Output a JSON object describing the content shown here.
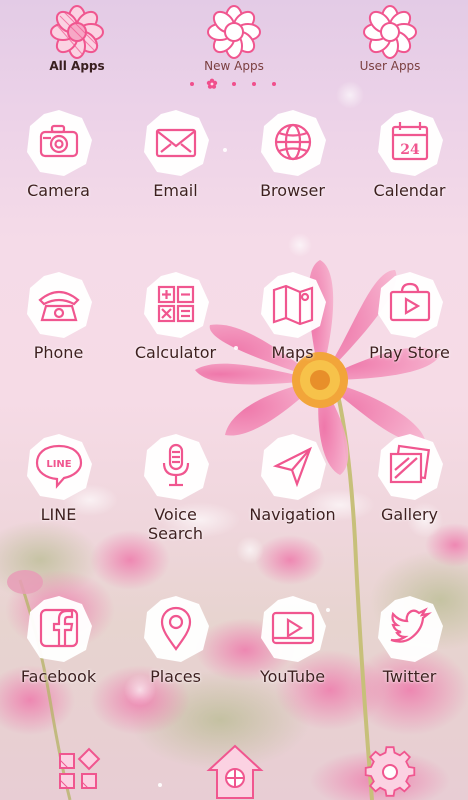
{
  "tabs": [
    {
      "label": "All Apps",
      "icon": "daisy-icon",
      "active": true
    },
    {
      "label": "New Apps",
      "icon": "daisy-icon",
      "active": false
    },
    {
      "label": "User Apps",
      "icon": "daisy-icon",
      "active": false
    }
  ],
  "pager": {
    "pages": 5,
    "current": 1
  },
  "apps": [
    {
      "label": "Camera",
      "icon": "camera-icon"
    },
    {
      "label": "Email",
      "icon": "envelope-icon"
    },
    {
      "label": "Browser",
      "icon": "globe-icon"
    },
    {
      "label": "Calendar",
      "icon": "calendar-icon",
      "day": "24"
    },
    {
      "label": "Phone",
      "icon": "phone-icon"
    },
    {
      "label": "Calculator",
      "icon": "calculator-icon"
    },
    {
      "label": "Maps",
      "icon": "map-icon"
    },
    {
      "label": "Play Store",
      "icon": "play-store-icon"
    },
    {
      "label": "LINE",
      "icon": "line-bubble-icon",
      "badge_text": "LINE"
    },
    {
      "label": "Voice\nSearch",
      "icon": "microphone-icon"
    },
    {
      "label": "Navigation",
      "icon": "navigation-arrow-icon"
    },
    {
      "label": "Gallery",
      "icon": "photos-icon"
    },
    {
      "label": "Facebook",
      "icon": "facebook-icon"
    },
    {
      "label": "Places",
      "icon": "location-pin-icon"
    },
    {
      "label": "YouTube",
      "icon": "youtube-icon"
    },
    {
      "label": "Twitter",
      "icon": "twitter-bird-icon"
    }
  ],
  "dock": [
    {
      "icon": "app-drawer-icon"
    },
    {
      "icon": "home-icon"
    },
    {
      "icon": "settings-gear-icon"
    }
  ],
  "colors": {
    "icon_pink": "#f0568f",
    "label_text": "#3e1f1f",
    "tab_text": "#7a3f3f",
    "pager_dot": "#f04f8c"
  }
}
